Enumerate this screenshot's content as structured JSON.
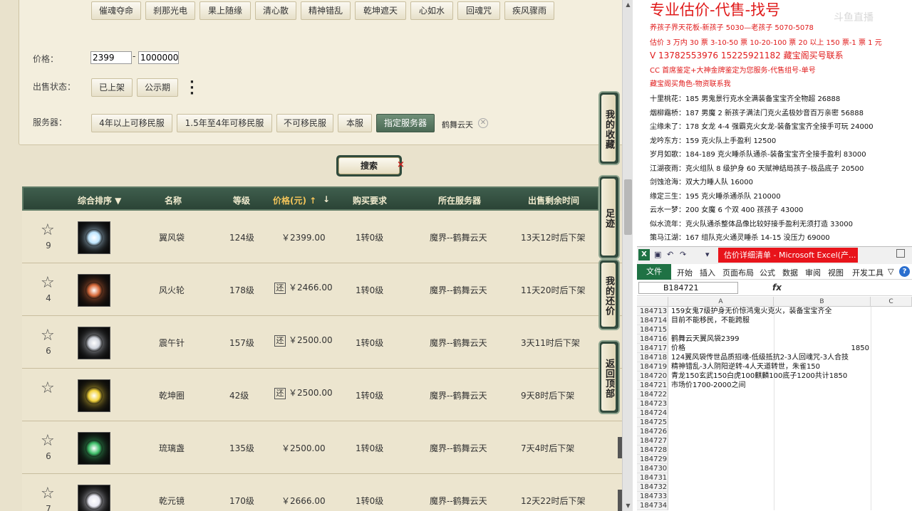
{
  "filters": {
    "schools": [
      "催魂夺命",
      "刹那光电",
      "果上随缘",
      "清心散",
      "精神错乱",
      "乾坤遮天",
      "心如水",
      "回魂咒",
      "疾风骤雨"
    ],
    "price_label": "价格：",
    "price_min": "2399",
    "price_max": "1000000",
    "sale_status_label": "出售状态：",
    "sale_status_options": [
      "已上架",
      "公示期"
    ],
    "more_icon": "more-dots-icon",
    "server_label": "服务器：",
    "server_options": [
      "4年以上可移民服",
      "1.5年至4年可移民服",
      "不可移民服",
      "本服",
      "指定服务器"
    ],
    "selected_server": "鹤舞云天",
    "clear_icon": "close-icon"
  },
  "search": {
    "label": "搜索",
    "close_mark": "×"
  },
  "table": {
    "headers": {
      "sort": "综合排序 ▼",
      "name": "名称",
      "level": "等级",
      "price": "价格(元) ↑",
      "price_down": "↓",
      "requirement": "购买要求",
      "server": "所在服务器",
      "time_left": "出售剩余时间"
    },
    "rows": [
      {
        "fav": "9",
        "name": "翼风袋",
        "level": "124级",
        "haggle": false,
        "price": "￥2399.00",
        "req": "1转0级",
        "server": "魔界--鹤舞云天",
        "time": "13天12时后下架",
        "color": "#bfe6ff"
      },
      {
        "fav": "4",
        "name": "风火轮",
        "level": "178级",
        "haggle": true,
        "price": "￥2466.00",
        "req": "1转0级",
        "server": "魔界--鹤舞云天",
        "time": "11天20时后下架",
        "color": "#d86a3a"
      },
      {
        "fav": "6",
        "name": "震午针",
        "level": "157级",
        "haggle": true,
        "price": "￥2500.00",
        "req": "1转0级",
        "server": "魔界--鹤舞云天",
        "time": "3天11时后下架",
        "color": "#cfd3dc"
      },
      {
        "fav": "",
        "name": "乾坤圈",
        "level": "42级",
        "haggle": true,
        "price": "￥2500.00",
        "req": "1转0级",
        "server": "魔界--鹤舞云天",
        "time": "9天8时后下架",
        "color": "#f2d23a"
      },
      {
        "fav": "6",
        "name": "琉璃盏",
        "level": "135级",
        "haggle": false,
        "price": "￥2500.00",
        "req": "1转0级",
        "server": "魔界--鹤舞云天",
        "time": "7天4时后下架",
        "color": "#3fbf6a"
      },
      {
        "fav": "7",
        "name": "乾元镜",
        "level": "170级",
        "haggle": false,
        "price": "￥2666.00",
        "req": "1转0级",
        "server": "魔界--鹤舞云天",
        "time": "12天22时后下架",
        "color": "#e8e8f2"
      }
    ],
    "haggle_mark": "还"
  },
  "side_tabs": [
    "我的收藏",
    "足迹",
    "我的还价",
    "返回顶部"
  ],
  "notes": {
    "title": "专业估价-代售-找号",
    "watermark": "斗鱼直播",
    "red_lines": [
      "养孩子界天花板-新孩子 5030—老孩子 5070-5078",
      "估价 3 万内 30 票  3-10-50 票  10-20-100 票  20 以上 150 票-1 票 1 元",
      "V 13782553976    15225921182   藏宝阁买号联系",
      "CC 首席鉴定+大神金牌鉴定为您服务-代售组号-单号",
      "藏宝阁买角色-物资联系我"
    ],
    "entries": [
      "十里桃花：185 男鬼景行克水全满装备宝宝齐全物超 26888",
      "烟柳霜桥：187 男魔 2 新孩子满法门克火孟极妙音百万亲密 56888",
      "尘缘未了：178 女龙 4-4 强霸克火女龙-装备宝宝齐全接手可玩 24000",
      "龙吟东方：159 克火队上手盈利 12500",
      "岁月如歌：184-189 克火睡杀队通杀-装备宝宝齐全接手盈利 83000",
      "江湖夜雨：克火组队 8 级护身 60 天赋神结局孩子-极品底子 20500",
      "剑蚀沧海：双大力睡人队 16000",
      "缘定三生：195 克火睡杀通杀队 210000",
      "云水一梦：200 女魔 6 个双 400 孩孩子 43000",
      "似水流年：克火队通杀整体品像比较好接手盈利无须打造 33000",
      "策马江湖：167 组队克火通灵睡杀 14-15 没压力 69000"
    ]
  },
  "excel": {
    "logo": "X",
    "doc_title": "估价详细清单 - Microsoft Excel(产...",
    "ribbon_tabs": [
      "文件",
      "开始",
      "插入",
      "页面布局",
      "公式",
      "数据",
      "审阅",
      "视图",
      "开发工具"
    ],
    "name_box": "B184721",
    "fx": "fx",
    "columns": [
      "A",
      "B",
      "C"
    ],
    "rows": [
      {
        "n": "184713",
        "a": "159女鬼7级护身无价惊鸿鬼火克火，装备宝宝齐全",
        "b": ""
      },
      {
        "n": "184714",
        "a": "目前不能移民，不能跨服",
        "b": ""
      },
      {
        "n": "184715",
        "a": "",
        "b": ""
      },
      {
        "n": "184716",
        "a": "鹤舞云天翼风袋2399",
        "b": ""
      },
      {
        "n": "184717",
        "a": "价格",
        "b": "1850"
      },
      {
        "n": "184718",
        "a": "124翼风袋传世品质招魂-低级抵抗2-3人回魂咒-3人合技",
        "b": ""
      },
      {
        "n": "184719",
        "a": "精神错乱-3人阴阳逆转-4人天道转世，朱雀150",
        "b": ""
      },
      {
        "n": "184720",
        "a": "青龙150玄武150白虎100麒麟100底子1200共计1850",
        "b": ""
      },
      {
        "n": "184721",
        "a": "市场价1700-2000之间",
        "b": ""
      },
      {
        "n": "184722",
        "a": "",
        "b": ""
      },
      {
        "n": "184723",
        "a": "",
        "b": ""
      },
      {
        "n": "184724",
        "a": "",
        "b": ""
      },
      {
        "n": "184725",
        "a": "",
        "b": ""
      },
      {
        "n": "184726",
        "a": "",
        "b": ""
      },
      {
        "n": "184727",
        "a": "",
        "b": ""
      },
      {
        "n": "184728",
        "a": "",
        "b": ""
      },
      {
        "n": "184729",
        "a": "",
        "b": ""
      },
      {
        "n": "184730",
        "a": "",
        "b": ""
      },
      {
        "n": "184731",
        "a": "",
        "b": ""
      },
      {
        "n": "184732",
        "a": "",
        "b": ""
      },
      {
        "n": "184733",
        "a": "",
        "b": ""
      },
      {
        "n": "184734",
        "a": "",
        "b": ""
      }
    ]
  }
}
